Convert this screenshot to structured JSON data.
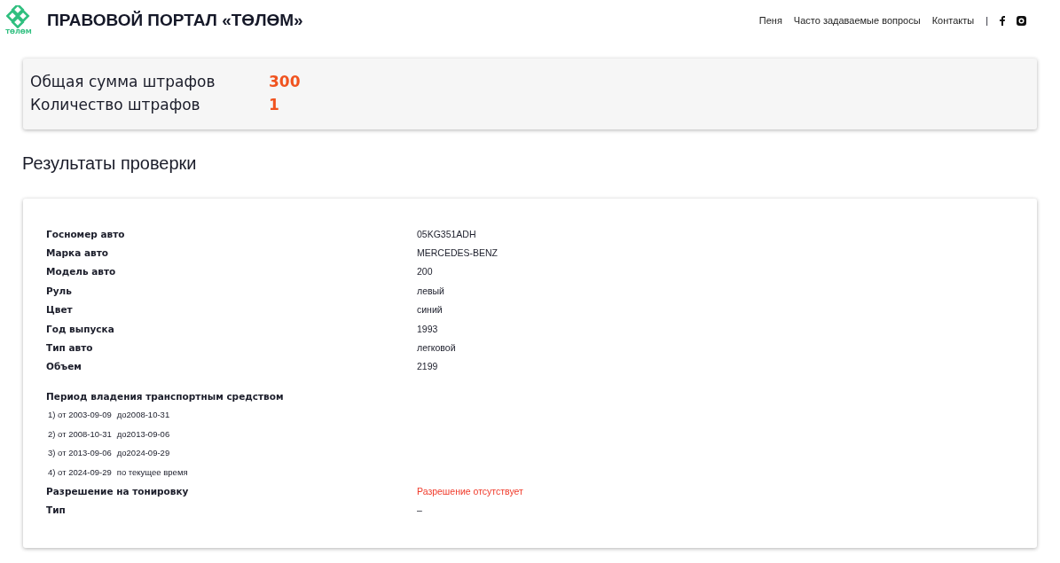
{
  "header": {
    "logo_text": "ТӨЛӨМ",
    "title": "ПРАВОВОЙ ПОРТАЛ «ТӨЛӨМ»",
    "nav": [
      "Пеня",
      "Часто задаваемые вопросы",
      "Контакты"
    ],
    "separator": "|"
  },
  "summary": [
    {
      "label": "Общая сумма штрафов",
      "value": "300"
    },
    {
      "label": "Количество штрафов",
      "value": "1"
    }
  ],
  "heading": "Результаты проверки",
  "details": [
    {
      "label": "Госномер авто",
      "value": "05KG351ADH",
      "kind": "normal"
    },
    {
      "label": "Марка авто",
      "value": "MERCEDES-BENZ",
      "kind": "normal"
    },
    {
      "label": "Модель авто",
      "value": "200",
      "kind": "normal"
    },
    {
      "label": "Руль",
      "value": "левый",
      "kind": "normal"
    },
    {
      "label": "Цвет",
      "value": "синий",
      "kind": "normal"
    },
    {
      "label": "Год выпуска",
      "value": "1993",
      "kind": "normal"
    },
    {
      "label": "Тип авто",
      "value": "легковой",
      "kind": "normal"
    },
    {
      "label": "Объем",
      "value": "2199",
      "kind": "normal"
    }
  ],
  "ownership": {
    "title": "Период владения транспортным средством",
    "periods": [
      {
        "from": "1) от 2003-09-09",
        "to": "до2008-10-31"
      },
      {
        "from": "2) от 2008-10-31",
        "to": "до2013-09-06"
      },
      {
        "from": "3) от 2013-09-06",
        "to": "до2024-09-29"
      },
      {
        "from": "4) от 2024-09-29",
        "to": "по текущее время"
      }
    ]
  },
  "details_after": [
    {
      "label": "Разрешение на тонировку",
      "value": "Разрешение отсутствует",
      "kind": "alert"
    },
    {
      "label": "Тип",
      "value": "–",
      "kind": "normal"
    }
  ]
}
